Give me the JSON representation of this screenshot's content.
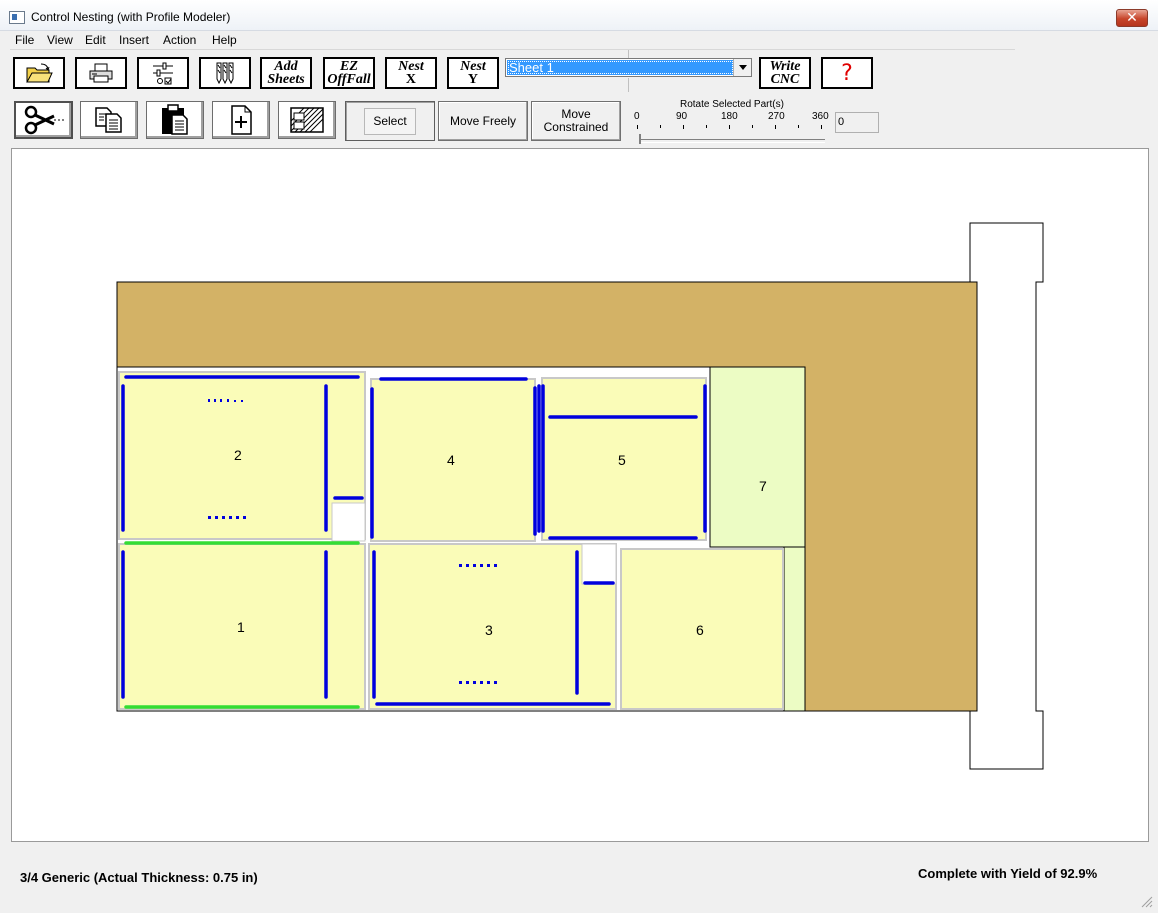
{
  "window": {
    "title": "Control Nesting (with Profile Modeler)",
    "close_glyph": "✕"
  },
  "menu": [
    "File",
    "View",
    "Edit",
    "Insert",
    "Action",
    "Help"
  ],
  "toolbar": {
    "add_sheets": [
      "Add",
      "Sheets"
    ],
    "ez_offfall": [
      "EZ",
      "OffFall"
    ],
    "nest_x": [
      "Nest",
      "X"
    ],
    "nest_y": [
      "Nest",
      "Y"
    ],
    "sheet_select": "Sheet 1",
    "write_cnc": [
      "Write",
      "CNC"
    ],
    "help": "?"
  },
  "icons": [
    "open-folder-icon",
    "print-icon",
    "settings-icon",
    "tools-icon",
    "scissors-icon",
    "copy-icon",
    "paste-icon",
    "new-part-icon",
    "hatch-icon"
  ],
  "modes": {
    "select": "Select",
    "move_freely": "Move Freely",
    "move_constrained": [
      "Move",
      "Constrained"
    ]
  },
  "rotate": {
    "label": "Rotate Selected Part(s)",
    "ticks": [
      "0",
      "90",
      "180",
      "270",
      "360"
    ],
    "value": "0"
  },
  "parts": [
    {
      "id": "2",
      "label": "2"
    },
    {
      "id": "4",
      "label": "4"
    },
    {
      "id": "5",
      "label": "5"
    },
    {
      "id": "7",
      "label": "7"
    },
    {
      "id": "1",
      "label": "1"
    },
    {
      "id": "3",
      "label": "3"
    },
    {
      "id": "6",
      "label": "6"
    }
  ],
  "colors": {
    "sheet": "#d3b266",
    "part": "#fafcb8",
    "offfall": "#ecfcc4",
    "edge_band": "#0000dd",
    "edge_band_alt": "#33dd33",
    "selection": "#3399ff"
  },
  "status": {
    "material": "3/4 Generic (Actual Thickness: 0.75 in)",
    "result": "Complete with Yield of 92.9%"
  }
}
